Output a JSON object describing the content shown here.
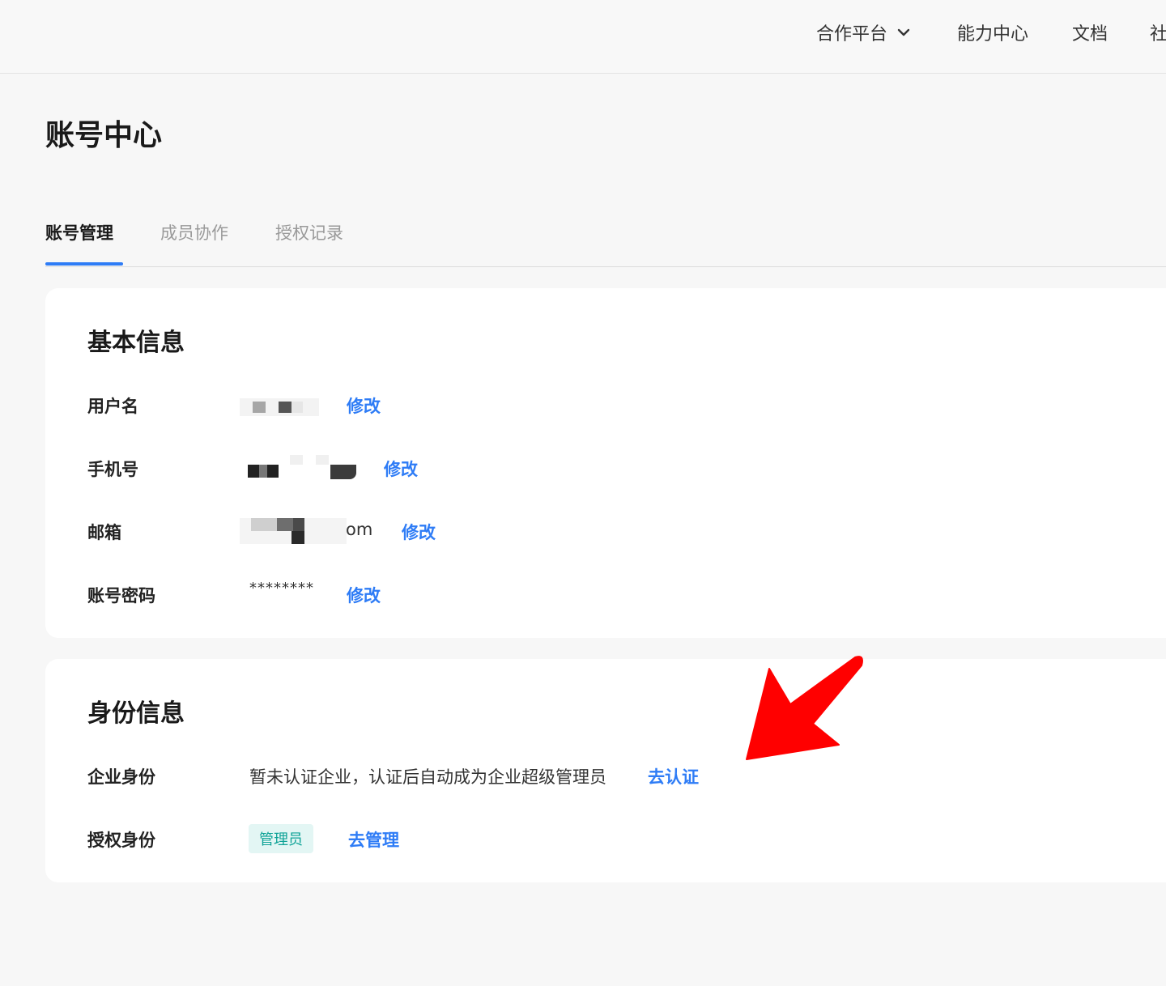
{
  "topnav": {
    "items": [
      {
        "label": "合作平台",
        "has_dropdown": true
      },
      {
        "label": "能力中心"
      },
      {
        "label": "文档"
      },
      {
        "label": "社"
      }
    ]
  },
  "page": {
    "title": "账号中心"
  },
  "tabs": [
    {
      "label": "账号管理",
      "active": true
    },
    {
      "label": "成员协作",
      "active": false
    },
    {
      "label": "授权记录",
      "active": false
    }
  ],
  "basic_info": {
    "title": "基本信息",
    "rows": [
      {
        "label": "用户名",
        "value": "",
        "action": "修改"
      },
      {
        "label": "手机号",
        "value": "",
        "action": "修改"
      },
      {
        "label": "邮箱",
        "value": "om",
        "action": "修改"
      },
      {
        "label": "账号密码",
        "value": "********",
        "action": "修改"
      }
    ]
  },
  "identity_info": {
    "title": "身份信息",
    "rows": [
      {
        "label": "企业身份",
        "value": "暂未认证企业，认证后自动成为企业超级管理员",
        "action": "去认证"
      },
      {
        "label": "授权身份",
        "badge": "管理员",
        "action": "去管理"
      }
    ]
  },
  "colors": {
    "accent": "#2e7cf6",
    "badge_text": "#0fa397",
    "badge_bg": "#e3f6f4",
    "annotation_arrow": "#ff0000"
  }
}
